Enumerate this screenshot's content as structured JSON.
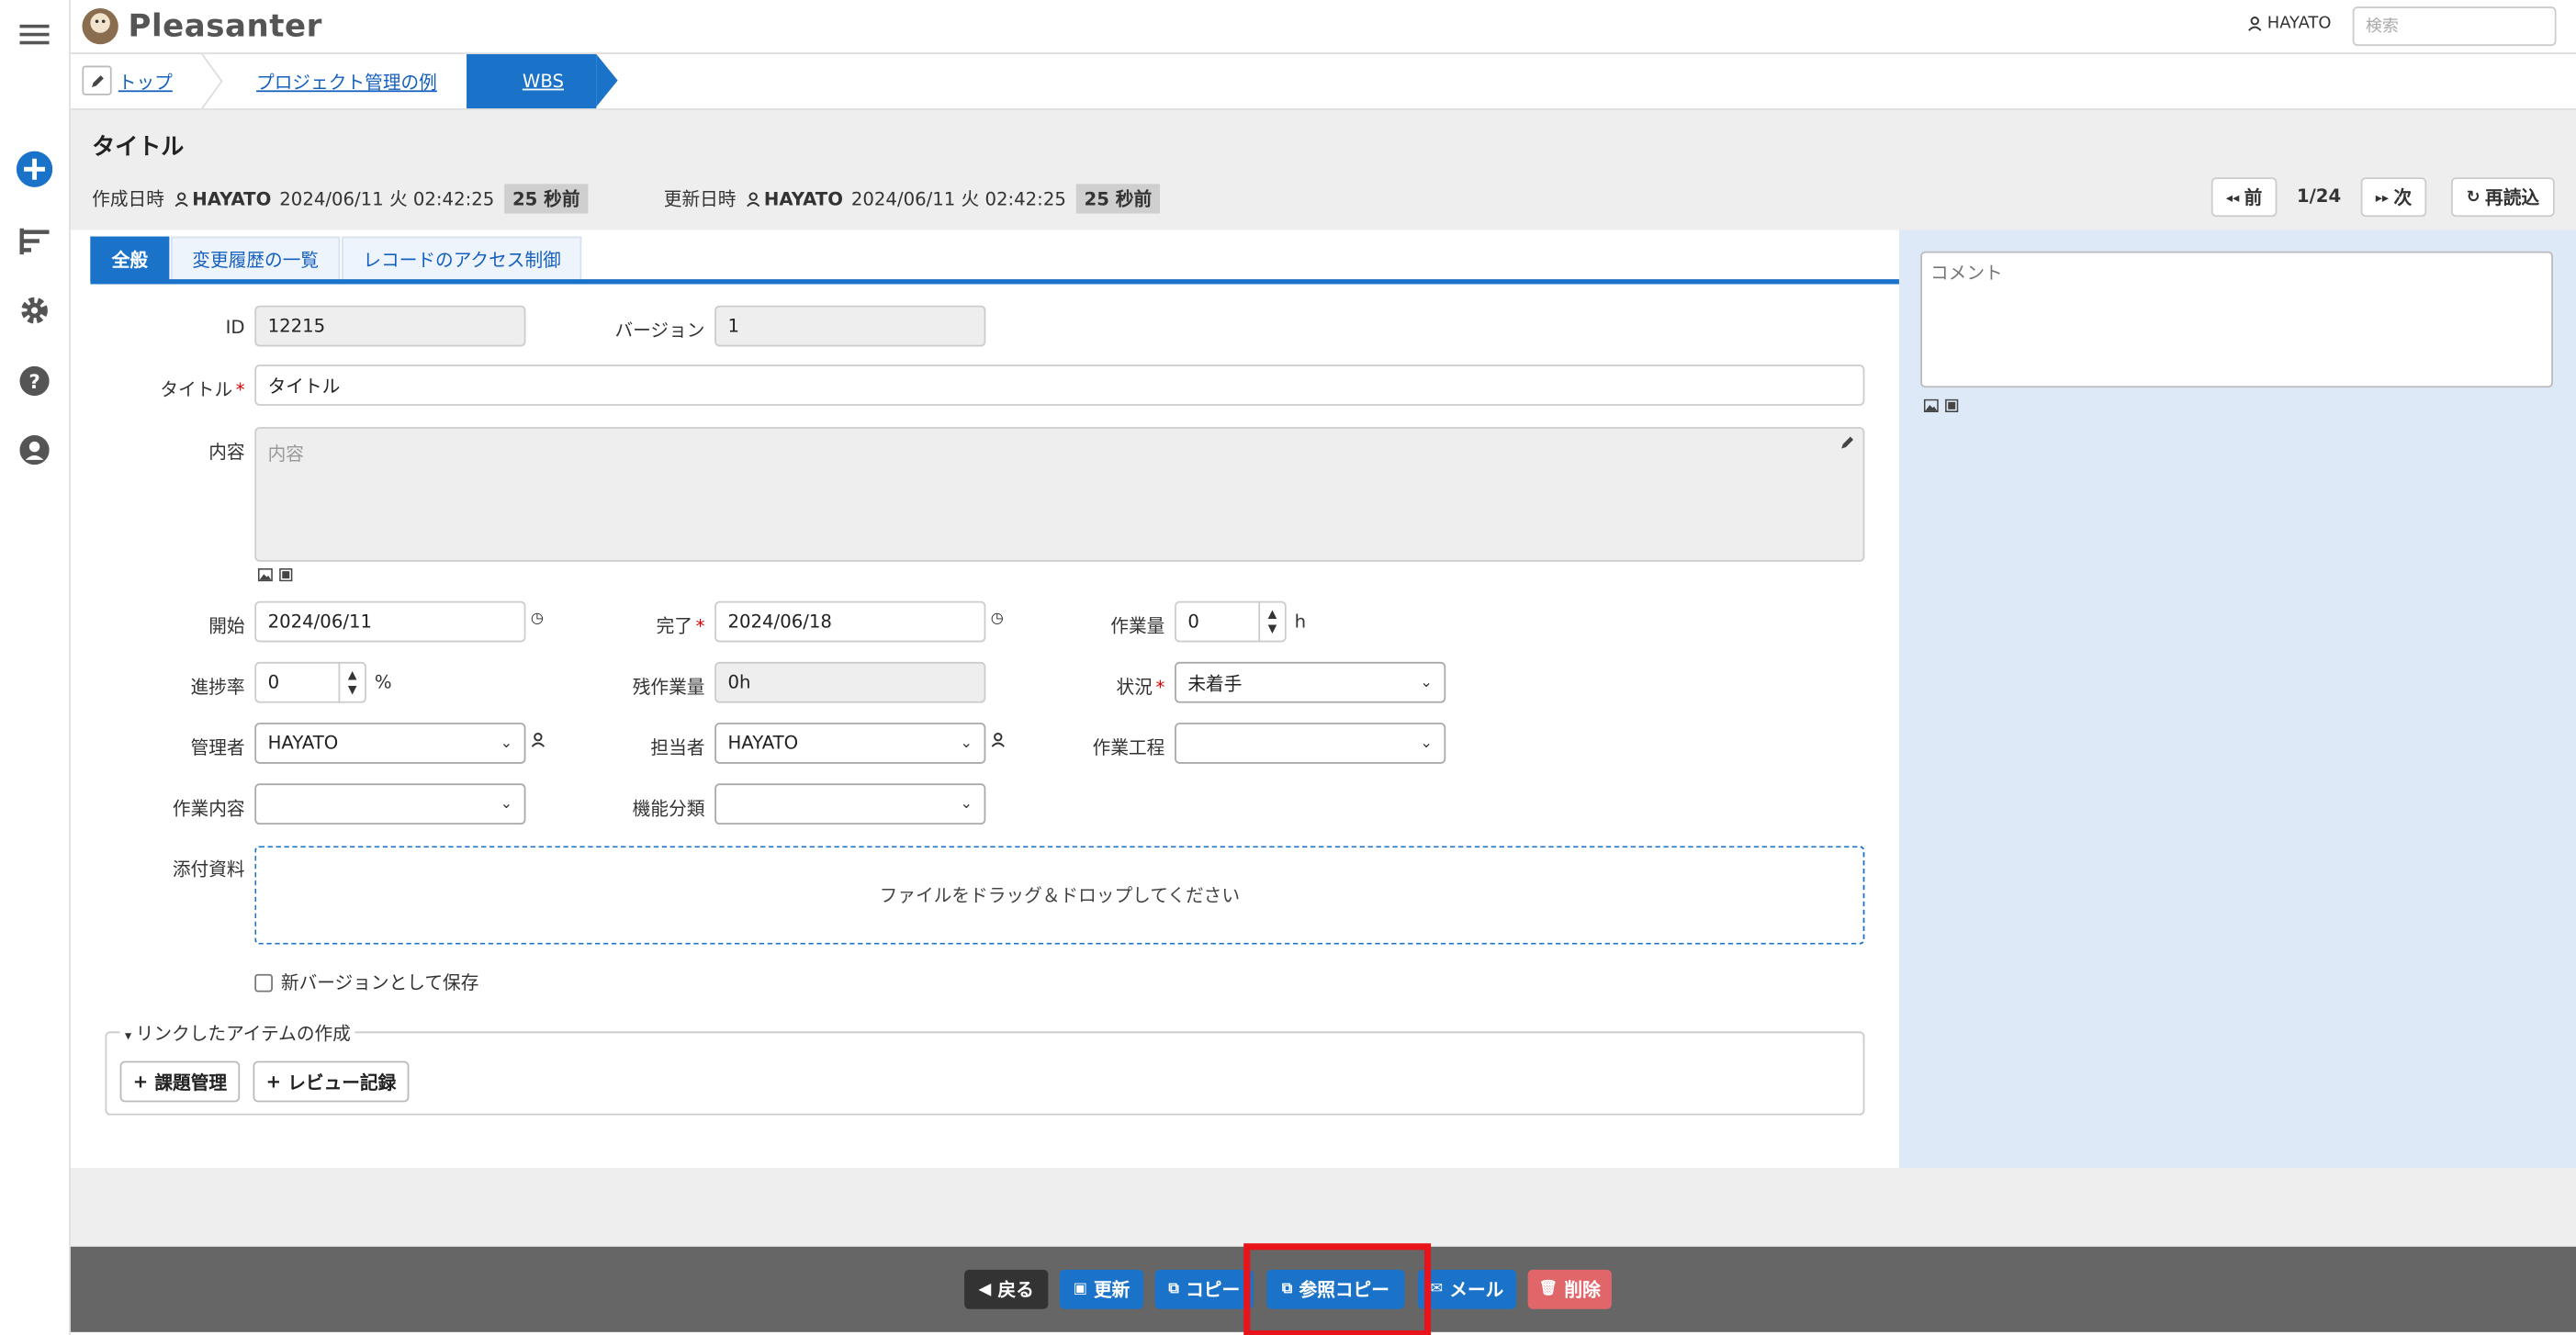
{
  "header": {
    "app_name": "Pleasanter",
    "user": "HAYATO",
    "search_placeholder": "検索"
  },
  "breadcrumb": {
    "items": [
      "トップ",
      "プロジェクト管理の例",
      "WBS"
    ]
  },
  "record": {
    "title": "タイトル",
    "created_label": "作成日時",
    "created_by": "HAYATO",
    "created_at": "2024/06/11 火 02:42:25",
    "created_ago": "25 秒前",
    "updated_label": "更新日時",
    "updated_by": "HAYATO",
    "updated_at": "2024/06/11 火 02:42:25",
    "updated_ago": "25 秒前",
    "prev_label": "前",
    "next_label": "次",
    "page": "1/24",
    "reload_label": "再読込"
  },
  "tabs": [
    "全般",
    "変更履歴の一覧",
    "レコードのアクセス制御"
  ],
  "fields": {
    "id_label": "ID",
    "id_value": "12215",
    "version_label": "バージョン",
    "version_value": "1",
    "title_label": "タイトル",
    "title_value": "タイトル",
    "body_label": "内容",
    "body_placeholder": "内容",
    "start_label": "開始",
    "start_value": "2024/06/11",
    "complete_label": "完了",
    "complete_value": "2024/06/18",
    "workload_label": "作業量",
    "workload_value": "0",
    "workload_unit": "h",
    "progress_label": "進捗率",
    "progress_value": "0",
    "progress_unit": "%",
    "remaining_label": "残作業量",
    "remaining_value": "0h",
    "status_label": "状況",
    "status_value": "未着手",
    "manager_label": "管理者",
    "manager_value": "HAYATO",
    "owner_label": "担当者",
    "owner_value": "HAYATO",
    "process_label": "作業工程",
    "process_value": "",
    "work_content_label": "作業内容",
    "work_content_value": "",
    "function_label": "機能分類",
    "function_value": "",
    "attachments_label": "添付資料",
    "dropzone_text": "ファイルをドラッグ＆ドロップしてください",
    "new_version_label": "新バージョンとして保存"
  },
  "linked": {
    "legend": "リンクしたアイテムの作成",
    "buttons": [
      "課題管理",
      "レビュー記録"
    ]
  },
  "comment": {
    "placeholder": "コメント"
  },
  "footer": {
    "back": "戻る",
    "update": "更新",
    "copy": "コピー",
    "ref_copy": "参照コピー",
    "mail": "メール",
    "delete": "削除"
  },
  "colors": {
    "accent": "#1a73c8",
    "footer_bg": "#666666",
    "delete": "#e0666a",
    "highlight": "#e8141b"
  }
}
